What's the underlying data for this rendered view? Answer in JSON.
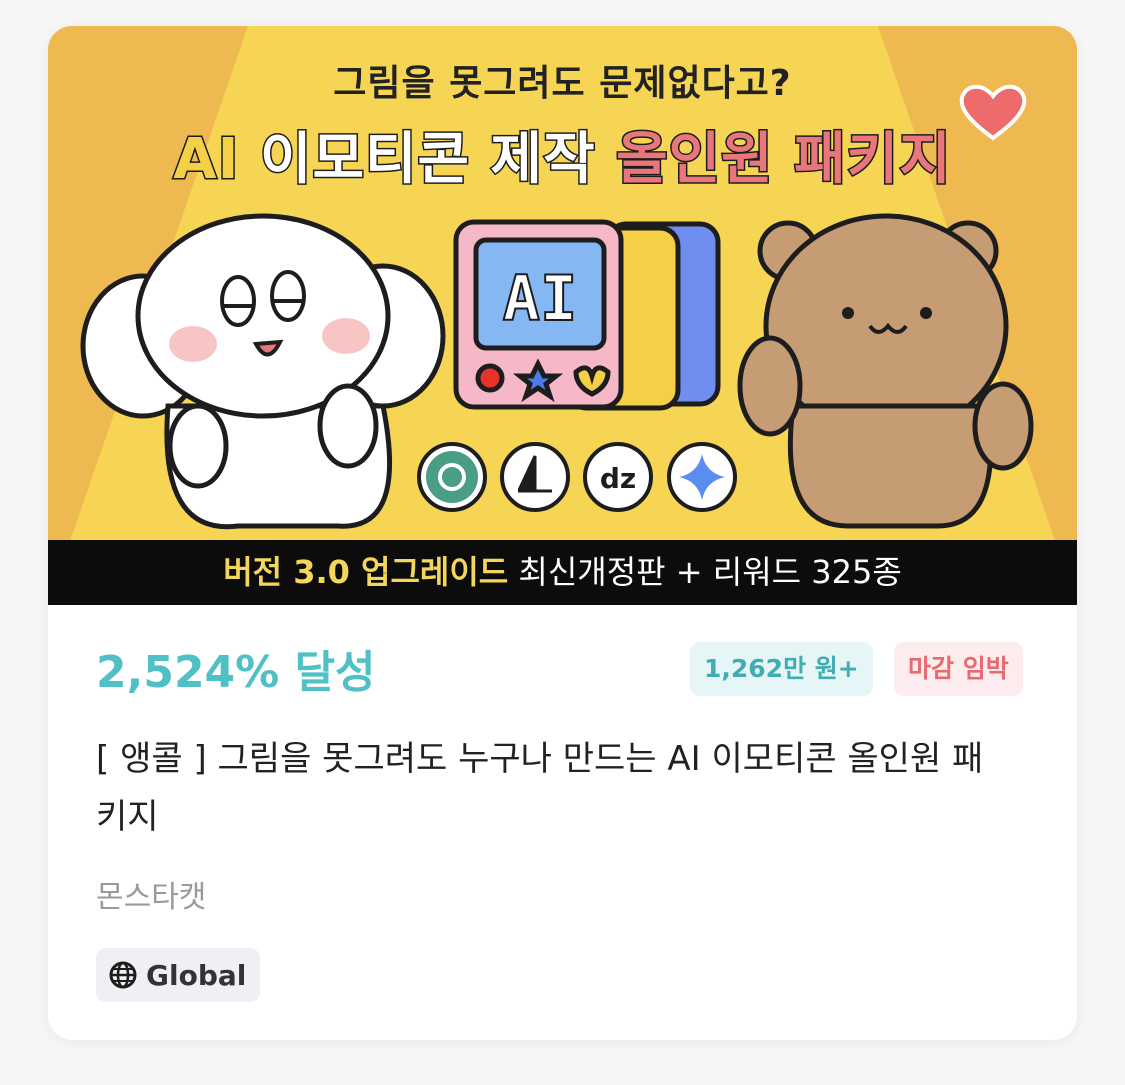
{
  "banner": {
    "headline_top": "그림을 못그려도 문제없다고?",
    "headline_ai": "AI",
    "headline_mid": "이모티콘 제작",
    "headline_pink": "올인원 패키지",
    "screen_text": "AI",
    "app_icons": [
      "chatgpt-icon",
      "midjourney-icon",
      "dz-icon",
      "gemini-icon"
    ],
    "dz_label": "dz",
    "strip_highlight": "버전 3.0 업그레이드",
    "strip_rest": "최신개정판 + 리워드 325종"
  },
  "favorite": {
    "icon": "heart-icon",
    "color": "#ee6b6b"
  },
  "card": {
    "achievement": "2,524% 달성",
    "amount_badge": "1,262만 원+",
    "deadline_badge": "마감 임박",
    "title": "[ 앵콜 ] 그림을 못그려도 누구나 만드는  AI 이모티콘 올인원 패키지",
    "creator": "몬스타캣",
    "region_label": "Global",
    "region_icon": "globe-icon"
  },
  "colors": {
    "accent_teal": "#4fc0c5",
    "deadline_red": "#e66a6f",
    "banner_yellow": "#f2c54a"
  }
}
